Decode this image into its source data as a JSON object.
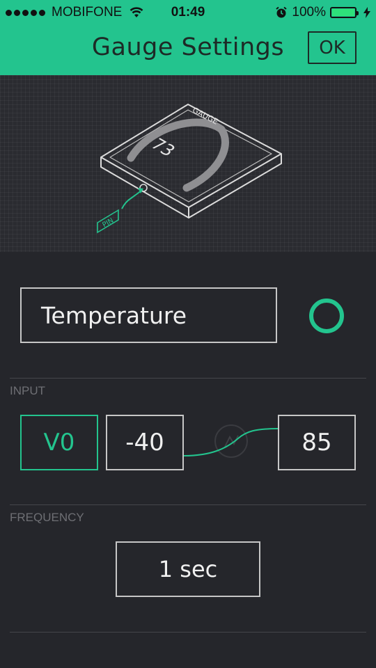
{
  "status_bar": {
    "carrier": "MOBIFONE",
    "time": "01:49",
    "battery": "100%",
    "battery_level": 1.0,
    "icons": [
      "signal-dots-icon",
      "wifi-icon",
      "alarm-icon",
      "battery-icon",
      "charging-bolt-icon"
    ]
  },
  "header": {
    "title": "Gauge Settings",
    "ok_label": "OK"
  },
  "preview": {
    "gauge_label": "GAUGE",
    "gauge_value": "73",
    "pin_label": "PIN"
  },
  "widget": {
    "name": "Temperature",
    "color": "#23c48e"
  },
  "input": {
    "section_label": "INPUT",
    "pin": "V0",
    "min": "-40",
    "max": "85"
  },
  "frequency": {
    "section_label": "FREQUENCY",
    "value": "1 sec"
  },
  "colors": {
    "accent": "#23c48e",
    "background": "#25262b",
    "border": "#c7c7c7"
  }
}
